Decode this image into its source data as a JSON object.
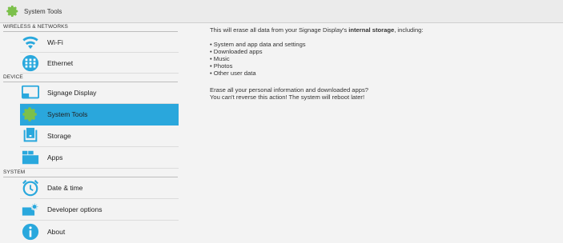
{
  "window": {
    "title": "System Tools"
  },
  "sidebar": {
    "sections": [
      {
        "label": "WIRELESS & NETWORKS"
      },
      {
        "label": "DEVICE"
      },
      {
        "label": "SYSTEM"
      }
    ],
    "items": [
      {
        "label": "Wi-Fi",
        "icon": "wifi-icon"
      },
      {
        "label": "Ethernet",
        "icon": "ethernet-icon"
      },
      {
        "label": "Signage Display",
        "icon": "display-icon"
      },
      {
        "label": "System Tools",
        "icon": "gear-icon",
        "selected": true
      },
      {
        "label": "Storage",
        "icon": "storage-icon"
      },
      {
        "label": "Apps",
        "icon": "apps-icon"
      },
      {
        "label": "Date & time",
        "icon": "clock-icon"
      },
      {
        "label": "Developer options",
        "icon": "developer-options-icon"
      },
      {
        "label": "About",
        "icon": "info-icon"
      }
    ]
  },
  "main": {
    "intro_pre": "This will erase all data from your Signage Display's ",
    "intro_bold": "internal storage",
    "intro_post": ", including:",
    "bullets": [
      "System and app data and settings",
      "Downloaded apps",
      "Music",
      "Photos",
      "Other user data"
    ],
    "warning_line1": "Erase all your personal information and downloaded apps?",
    "warning_line2": "You can't reverse this action! The system will reboot later!"
  },
  "colors": {
    "accent": "#2aa7dc",
    "icon_blue": "#29a8dd",
    "background": "#f3f3f3"
  }
}
